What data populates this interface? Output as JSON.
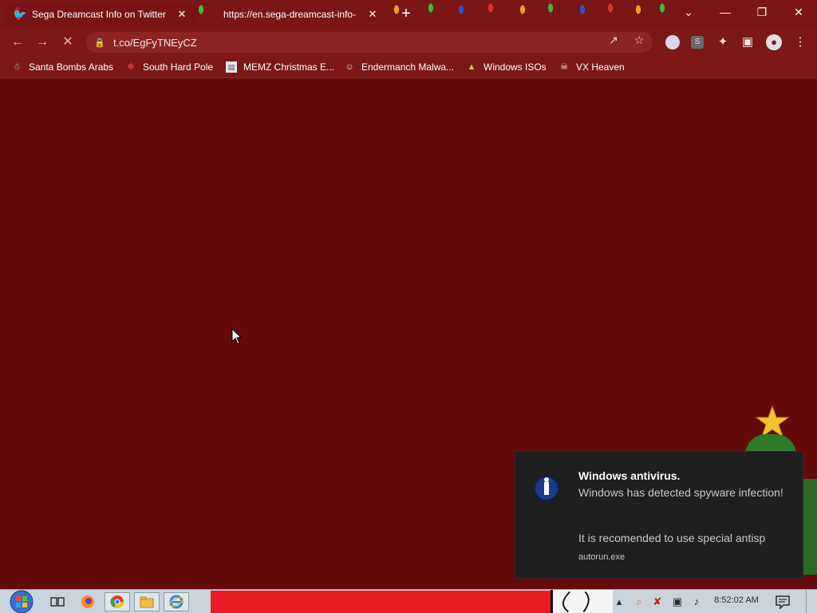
{
  "tabs": [
    {
      "title": "Sega Dreamcast Info on Twitter",
      "favicon": "twitter-bird-icon",
      "active": true
    },
    {
      "title": "https://en.sega-dreamcast-info-",
      "active": false
    }
  ],
  "window_controls": {
    "dropdown": "chevron-down-icon",
    "minimize": "minimize-icon",
    "restore": "restore-icon",
    "close": "close-icon"
  },
  "omnibox": {
    "url": "t.co/EgFyTNEyCZ"
  },
  "bookmarks": [
    {
      "label": "Santa Bombs Arabs",
      "icon": "santa-icon"
    },
    {
      "label": "South Hard Pole",
      "icon": "snowflake-icon"
    },
    {
      "label": "MEMZ Christmas E...",
      "icon": "memz-icon"
    },
    {
      "label": "Endermanch Malwa...",
      "icon": "enderman-icon"
    },
    {
      "label": "Windows ISOs",
      "icon": "tree-icon"
    },
    {
      "label": "VX Heaven",
      "icon": "vx-icon"
    }
  ],
  "notification": {
    "title": "Windows antivirus.",
    "body": "Windows has detected spyware infection!",
    "body2": "It is recomended to use special antisp",
    "app": "autorun.exe"
  },
  "taskbar": {
    "clock": "8:52:02 AM"
  },
  "colors": {
    "page_background": "#650a0a",
    "toolbar": "#7c1818",
    "notification_bg": "#1f1f1f",
    "taskbar": "#c9d3dc",
    "taskbar_red": "#ec1c24"
  }
}
